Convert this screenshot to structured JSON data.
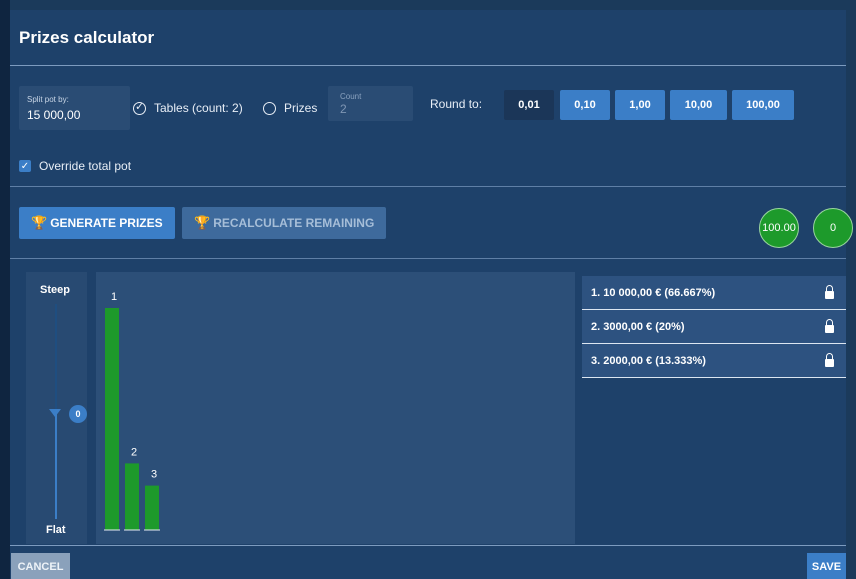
{
  "title": "Prizes calculator",
  "split": {
    "label": "Split pot by:",
    "value": "15 000,00"
  },
  "mode": {
    "tables_label": "Tables (count: 2)",
    "prizes_label": "Prizes",
    "selected": "tables"
  },
  "count": {
    "label": "Count",
    "value": "2"
  },
  "round": {
    "label": "Round to:",
    "options": [
      "0,01",
      "0,10",
      "1,00",
      "10,00",
      "100,00"
    ],
    "selected": "0,01"
  },
  "override": {
    "label": "Override total pot",
    "checked": true
  },
  "buttons": {
    "generate": "GENERATE PRIZES",
    "recalculate": "RECALCULATE REMAINING",
    "cancel": "CANCEL",
    "save": "SAVE"
  },
  "indicators": {
    "percent": "100.00",
    "remaining": "0"
  },
  "slider": {
    "top_label": "Steep",
    "bottom_label": "Flat",
    "value": "0"
  },
  "chart_data": {
    "type": "bar",
    "categories": [
      "1",
      "2",
      "3"
    ],
    "values": [
      10000,
      3000,
      2000
    ]
  },
  "prizes": [
    {
      "text": "1. 10 000,00 € (66.667%)",
      "locked": true
    },
    {
      "text": "2. 3000,00 € (20%)",
      "locked": true
    },
    {
      "text": "3. 2000,00 € (13.333%)",
      "locked": true
    }
  ],
  "colors": {
    "accent": "#3b7ec7",
    "bar": "#1d9a2b",
    "background": "#1e416a"
  }
}
